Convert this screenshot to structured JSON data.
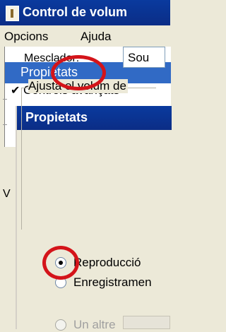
{
  "main_window": {
    "title": "Control de volum",
    "menu": {
      "opcions": "Opcions",
      "ajuda": "Ajuda"
    },
    "dropdown": {
      "selected_item": "Propietats",
      "checked_item": "Controls avançats"
    },
    "left_fragment": "V"
  },
  "dialog": {
    "title": "Propietats",
    "mixer_label": "Mesclador:",
    "mixer_value": "Sou",
    "group_legend": "Ajusta el volum de",
    "options": {
      "playback": "Reproducció",
      "record": "Enregistramen",
      "other": "Un altre"
    },
    "selected_option": "playback"
  },
  "highlight_color": "#d4141a",
  "accent": "#0a3a9e"
}
